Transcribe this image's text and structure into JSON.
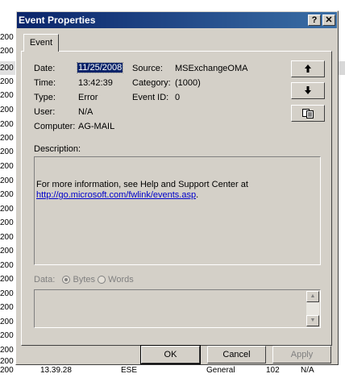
{
  "background": {
    "rows": [
      "200",
      "200",
      "200",
      "200",
      "200",
      "200",
      "200",
      "200",
      "200",
      "200",
      "200",
      "200",
      "200",
      "200",
      "200",
      "200",
      "200",
      "200",
      "200",
      "200",
      "200",
      "200",
      "200",
      "200",
      "200"
    ],
    "bottom_row": {
      "time": "13.39.28",
      "col2": "ESE",
      "col3": "General",
      "col4": "102",
      "col5": "N/A"
    }
  },
  "dialog": {
    "title": "Event Properties",
    "help_glyph": "?",
    "close_glyph": "✕",
    "tab_label": "Event",
    "fields": {
      "date_label": "Date:",
      "date_value": "11/25/2008",
      "time_label": "Time:",
      "time_value": "13:42:39",
      "type_label": "Type:",
      "type_value": "Error",
      "user_label": "User:",
      "user_value": "N/A",
      "computer_label": "Computer:",
      "computer_value": "AG-MAIL",
      "source_label": "Source:",
      "source_value": "MSExchangeOMA",
      "category_label": "Category:",
      "category_value": "(1000)",
      "eventid_label": "Event ID:",
      "eventid_value": "0"
    },
    "description_label": "Description:",
    "description_text": "For more information, see Help and Support Center at",
    "description_link": "http://go.microsoft.com/fwlink/events.asp",
    "description_link_suffix": ".",
    "data_label": "Data:",
    "bytes_label": "Bytes",
    "words_label": "Words",
    "buttons": {
      "ok": "OK",
      "cancel": "Cancel",
      "apply": "Apply"
    },
    "icons": {
      "up": "arrow-up-icon",
      "down": "arrow-down-icon",
      "copy": "copy-icon"
    }
  }
}
